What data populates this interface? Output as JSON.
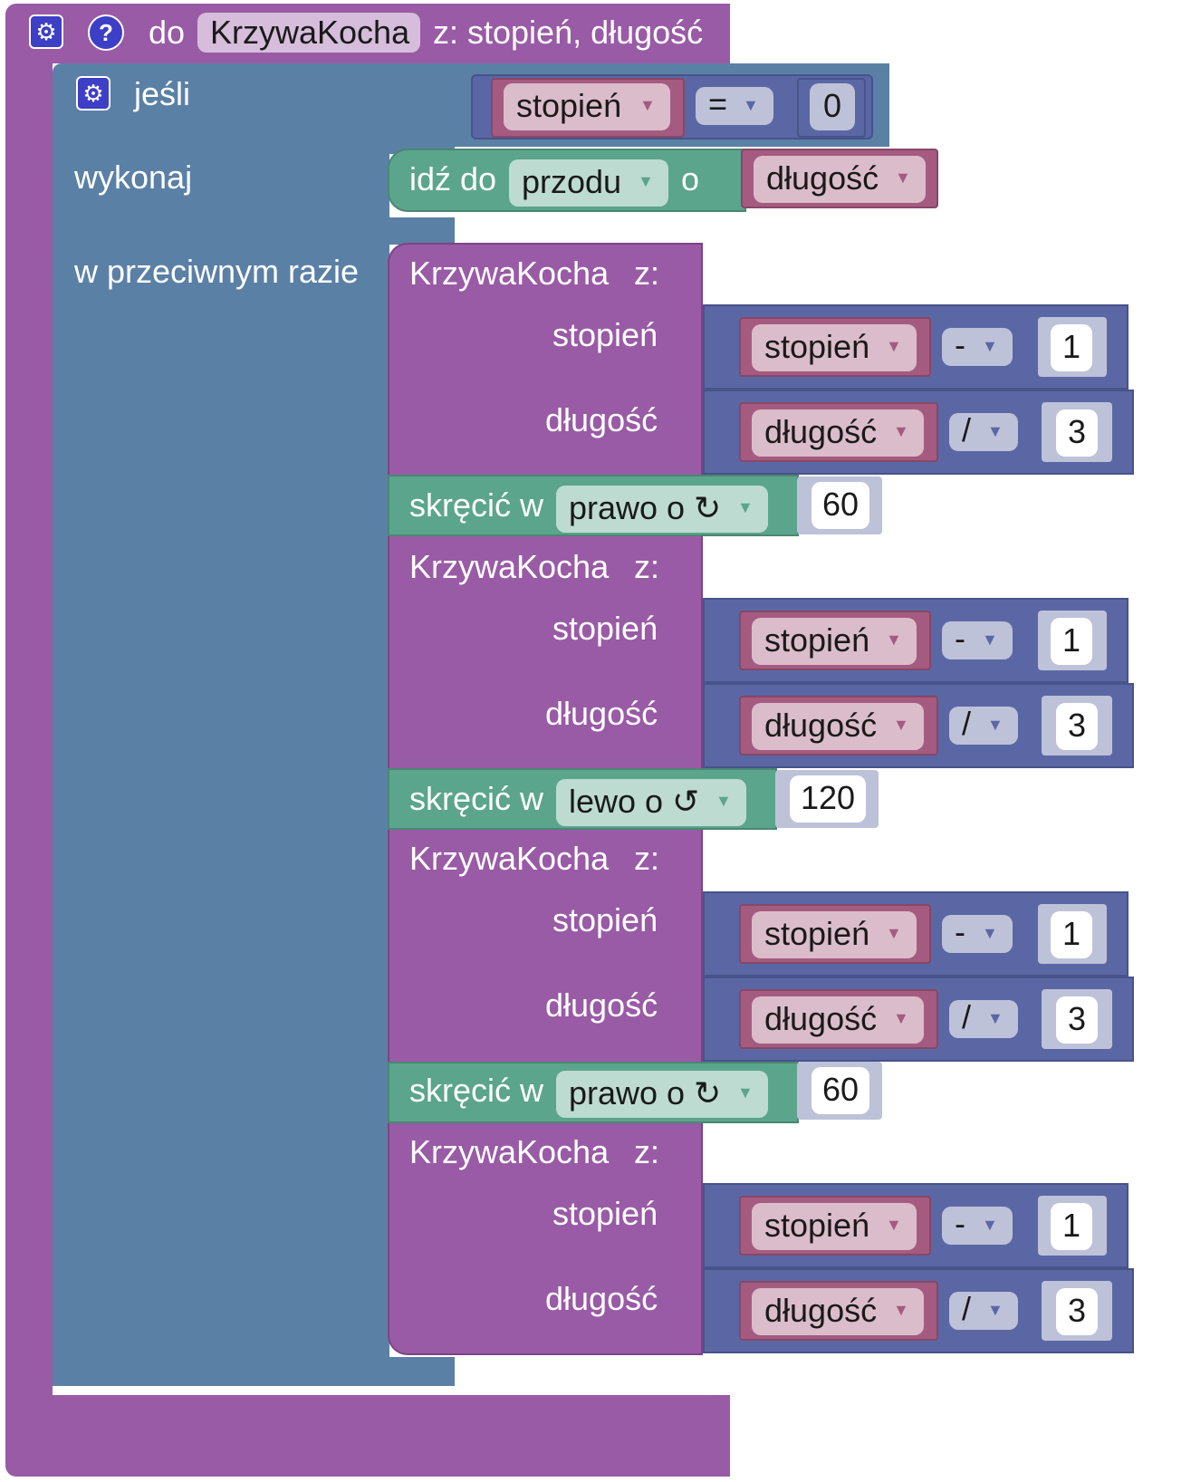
{
  "procedure": {
    "keyword": "do",
    "name": "KrzywaKocha",
    "params_label": "z: stopień, długość"
  },
  "if_block": {
    "if_label": "jeśli",
    "do_label": "wykonaj",
    "else_label": "w przeciwnym razie",
    "condition": {
      "var": "stopień",
      "op": "=",
      "value": "0"
    }
  },
  "forward_block": {
    "label": "idź do",
    "direction": "przodu",
    "by_label": "o",
    "var": "długość"
  },
  "calls": [
    {
      "name": "KrzywaKocha",
      "with_label": "z:",
      "arg1_label": "stopień",
      "arg1_var": "stopień",
      "arg1_op": "-",
      "arg1_num": "1",
      "arg2_label": "długość",
      "arg2_var": "długość",
      "arg2_op": "/",
      "arg2_num": "3"
    },
    {
      "name": "KrzywaKocha",
      "with_label": "z:",
      "arg1_label": "stopień",
      "arg1_var": "stopień",
      "arg1_op": "-",
      "arg1_num": "1",
      "arg2_label": "długość",
      "arg2_var": "długość",
      "arg2_op": "/",
      "arg2_num": "3"
    },
    {
      "name": "KrzywaKocha",
      "with_label": "z:",
      "arg1_label": "stopień",
      "arg1_var": "stopień",
      "arg1_op": "-",
      "arg1_num": "1",
      "arg2_label": "długość",
      "arg2_var": "długość",
      "arg2_op": "/",
      "arg2_num": "3"
    },
    {
      "name": "KrzywaKocha",
      "with_label": "z:",
      "arg1_label": "stopień",
      "arg1_var": "stopień",
      "arg1_op": "-",
      "arg1_num": "1",
      "arg2_label": "długość",
      "arg2_var": "długość",
      "arg2_op": "/",
      "arg2_num": "3"
    }
  ],
  "turns": [
    {
      "label": "skręcić w",
      "direction": "prawo o ↻",
      "value": "60"
    },
    {
      "label": "skręcić w",
      "direction": "lewo o ↺",
      "value": "120"
    },
    {
      "label": "skręcić w",
      "direction": "prawo o ↻",
      "value": "60"
    }
  ],
  "icons": {
    "settings": "gear-icon",
    "help": "help-icon",
    "dropdown": "dropdown-arrow-icon"
  },
  "colors": {
    "procedure": "#995ba5",
    "logic": "#5b80a5",
    "math": "#5b67a5",
    "variable": "#a55b80",
    "turtle": "#5ba58c"
  }
}
